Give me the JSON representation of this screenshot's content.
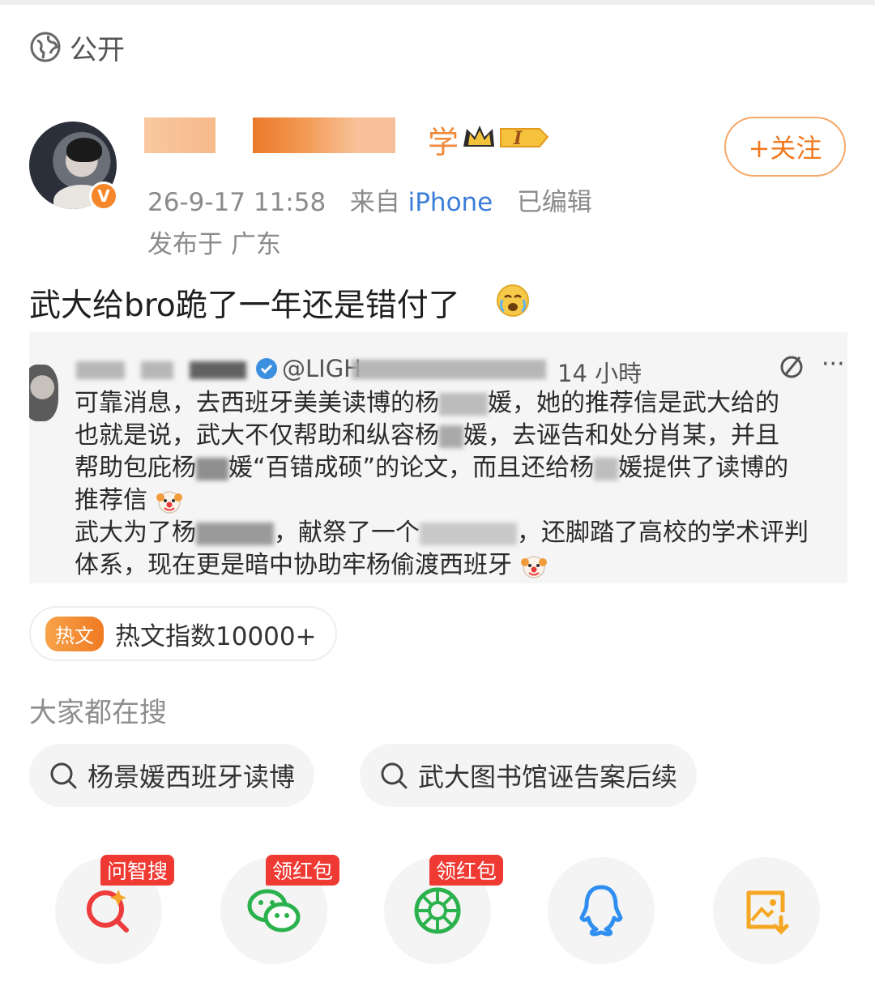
{
  "visibility": {
    "label": "公开",
    "icon": "globe-icon"
  },
  "user": {
    "name_visible_tail": "学",
    "level_badge": "I",
    "meta_time": "26-9-17 11:58",
    "meta_from": "来自",
    "meta_source": "iPhone",
    "meta_edited": "已编辑",
    "location": "发布于 广东"
  },
  "follow_button": {
    "label": "+关注"
  },
  "post": {
    "text": "武大给bro跪了一年还是错付了"
  },
  "embedded": {
    "handle": "@LIGH",
    "time": "14 小時",
    "lines": [
      "可靠消息，去西班牙美美读博的杨",
      "媛，她的推荐信是武大给的",
      "也就是说，武大不仅帮助和纵容杨",
      "媛，去诬告和处分肖某，并且",
      "帮助包庇杨",
      "媛“百错成硕”的论文，而且还给杨",
      "媛提供了读博的",
      "推荐信",
      "武大为了杨",
      "，献祭了一个",
      "，还脚踏了高校的学术评判",
      "体系，现在更是暗中协助牢杨偷渡西班牙"
    ]
  },
  "hot": {
    "tag": "热文",
    "text": "热文指数10000+"
  },
  "search": {
    "title": "大家都在搜",
    "chips": [
      "杨景媛西班牙读博",
      "武大图书馆诬告案后续"
    ]
  },
  "share": [
    {
      "icon": "ai-search-icon",
      "badge": "问智搜"
    },
    {
      "icon": "wechat-icon",
      "badge": "领红包"
    },
    {
      "icon": "moments-icon",
      "badge": "领红包"
    },
    {
      "icon": "qq-icon",
      "badge": ""
    },
    {
      "icon": "save-image-icon",
      "badge": ""
    }
  ],
  "colors": {
    "accent": "#f07a22",
    "link": "#3b7dd8",
    "badge_red": "#ef3a33"
  }
}
